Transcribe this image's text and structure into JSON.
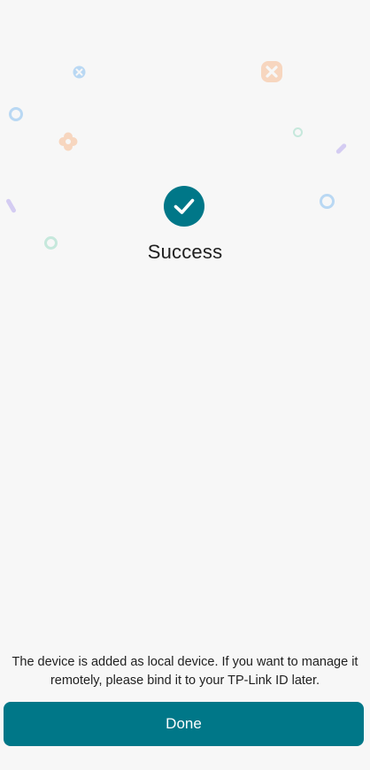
{
  "colors": {
    "accent": "#007788",
    "background": "#f7f7f7",
    "text": "#1f1f1f",
    "confetti_blue": "#b9d8f3",
    "confetti_orange": "#f7d6bf",
    "confetti_green": "#c6e8dc",
    "confetti_purple": "#d4ccf2"
  },
  "status": {
    "icon": "checkmark-circle-icon",
    "title": "Success"
  },
  "message": {
    "text": "The device is added as local device. If you want to manage it remotely, please bind it to your TP-Link ID later."
  },
  "actions": {
    "done_label": "Done"
  }
}
